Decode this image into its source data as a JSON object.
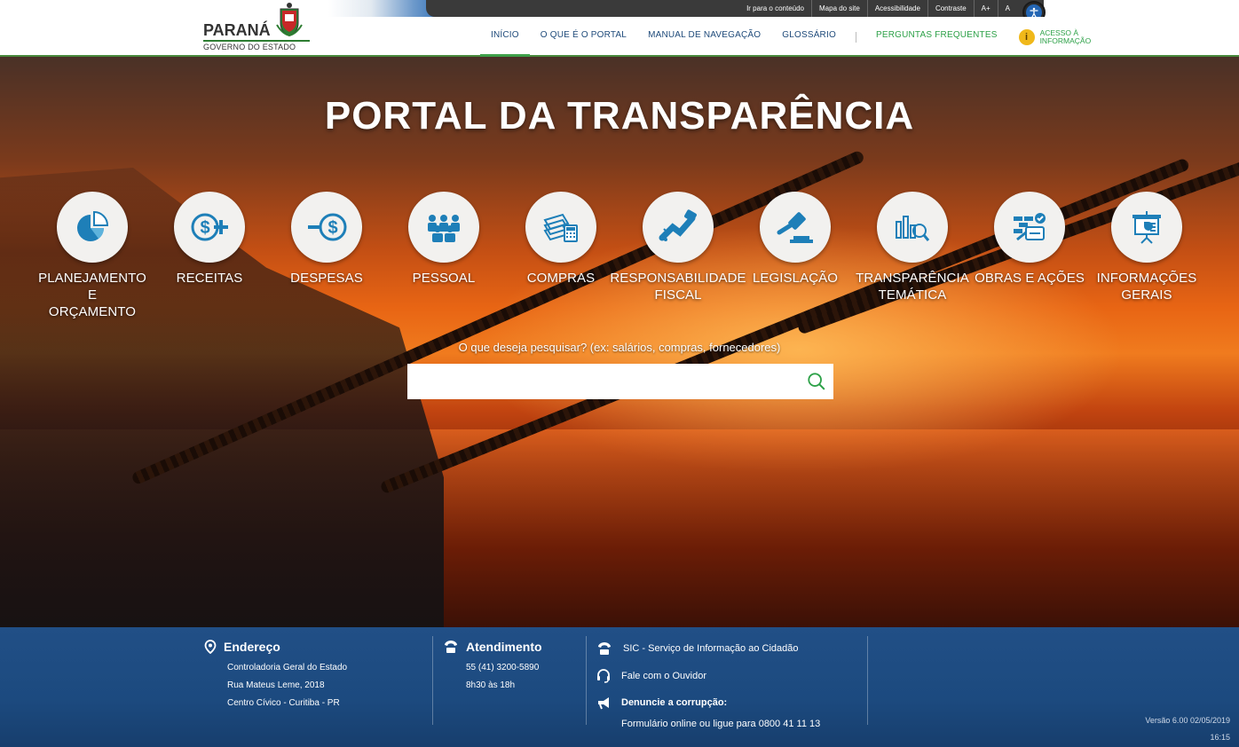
{
  "utility": {
    "links": [
      "Ir para o conteúdo",
      "Mapa do site",
      "Acessibilidade",
      "Contraste",
      "A+",
      "A"
    ]
  },
  "logo": {
    "name": "PARANÁ",
    "subtitle": "GOVERNO DO ESTADO"
  },
  "nav": {
    "items": [
      "INÍCIO",
      "O QUE É O PORTAL",
      "MANUAL DE NAVEGAÇÃO",
      "GLOSSÁRIO"
    ],
    "faq": "PERGUNTAS FREQUENTES",
    "acesso_line1": "ACESSO À",
    "acesso_line2": "INFORMAÇÃO"
  },
  "hero": {
    "title": "PORTAL DA TRANSPARÊNCIA",
    "categories": [
      {
        "label1": "PLANEJAMENTO E",
        "label2": "ORÇAMENTO",
        "icon": "pie-chart-icon"
      },
      {
        "label1": "RECEITAS",
        "label2": "",
        "icon": "dollar-plus-icon"
      },
      {
        "label1": "DESPESAS",
        "label2": "",
        "icon": "dollar-minus-icon"
      },
      {
        "label1": "PESSOAL",
        "label2": "",
        "icon": "people-icon"
      },
      {
        "label1": "COMPRAS",
        "label2": "",
        "icon": "money-calculator-icon"
      },
      {
        "label1": "RESPONSABILIDADE",
        "label2": "FISCAL",
        "icon": "handshake-icon"
      },
      {
        "label1": "LEGISLAÇÃO",
        "label2": "",
        "icon": "gavel-icon"
      },
      {
        "label1": "TRANSPARÊNCIA",
        "label2": "TEMÁTICA",
        "icon": "chart-search-icon"
      },
      {
        "label1": "OBRAS E AÇÕES",
        "label2": "",
        "icon": "construction-icon"
      },
      {
        "label1": "INFORMAÇÕES",
        "label2": "GERAIS",
        "icon": "presentation-icon"
      }
    ],
    "search_label": "O que deseja pesquisar? (ex: salários, compras, fornecedores)",
    "search_value": ""
  },
  "footer": {
    "endereco_title": "Endereço",
    "endereco_lines": [
      "Controladoria Geral do Estado",
      "Rua Mateus Leme, 2018",
      "Centro Cívico - Curitiba - PR"
    ],
    "atendimento_title": "Atendimento",
    "atendimento_lines": [
      "55 (41) 3200-5890",
      "8h30 às 18h"
    ],
    "sic": "SIC - Serviço de Informação ao Cidadão",
    "ouvidor": "Fale com o Ouvidor",
    "denuncie_title": "Denuncie a corrupção:",
    "denuncie_text": "Formulário online ou ligue para 0800 41 11 13",
    "version": "Versão 6.00 02/05/2019",
    "time": "16:15"
  },
  "colors": {
    "primary_blue": "#1e4a7a",
    "accent_green": "#2da148",
    "icon_blue": "#1e7fb8",
    "footer_blue": "#1c4a7f"
  }
}
